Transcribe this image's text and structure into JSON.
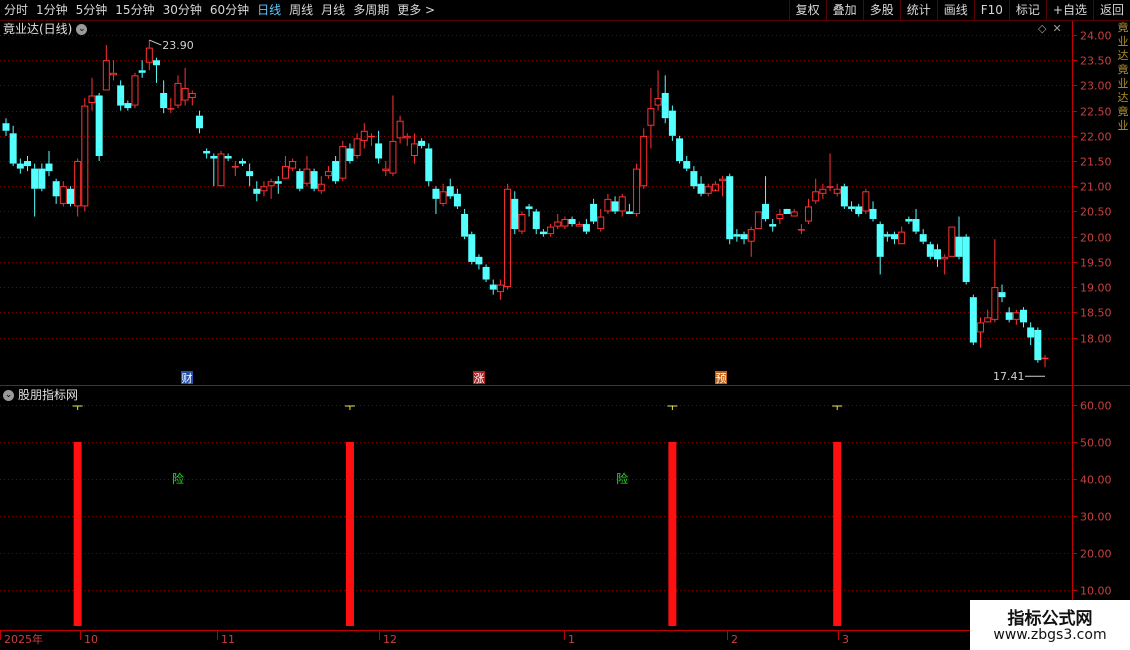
{
  "toolbar": {
    "periods": [
      "分时",
      "1分钟",
      "5分钟",
      "15分钟",
      "30分钟",
      "60分钟",
      "日线",
      "周线",
      "月线",
      "多周期",
      "更多 >"
    ],
    "active_period": "日线",
    "right_buttons": [
      "复权",
      "叠加",
      "多股",
      "统计",
      "画线",
      "F10",
      "标记",
      "+自选",
      "返回"
    ]
  },
  "main_title": "竟业达(日线)",
  "sub_title": "股朋指标网",
  "side_strip": "竟业达竟业达竟业",
  "colors": {
    "up": "#ff3232",
    "down": "#54ffff",
    "signal": "#ff1010",
    "grid": "#7a0000",
    "axis": "#c00000",
    "label_green": "#2ee02e",
    "marker_yellow": "#e8e840"
  },
  "chart_data": [
    {
      "type": "candlestick",
      "title": "竟业达(日线)",
      "ylim": [
        17.0,
        24.4
      ],
      "yticks": [
        "24.00",
        "23.50",
        "23.00",
        "22.50",
        "22.00",
        "21.50",
        "21.00",
        "20.50",
        "20.00",
        "19.50",
        "19.00",
        "18.50",
        "18.00"
      ],
      "max_label": "23.90",
      "min_label": "17.41",
      "event_markers": [
        "财",
        "涨",
        "预"
      ],
      "x_ticks": [
        "2025年",
        "10",
        "11",
        "12",
        "1",
        "2",
        "3"
      ],
      "candles": [
        [
          22.25,
          22.1,
          22.35,
          22.0
        ],
        [
          22.05,
          21.45,
          22.2,
          21.4
        ],
        [
          21.45,
          21.35,
          21.55,
          21.25
        ],
        [
          21.5,
          21.4,
          21.6,
          21.3
        ],
        [
          21.35,
          20.95,
          21.45,
          20.4
        ],
        [
          21.35,
          20.95,
          21.45,
          20.9
        ],
        [
          21.45,
          21.3,
          21.7,
          21.2
        ],
        [
          21.1,
          20.8,
          21.15,
          20.65
        ],
        [
          20.65,
          21.0,
          21.1,
          20.6
        ],
        [
          20.95,
          20.65,
          21.0,
          20.6
        ],
        [
          20.6,
          21.5,
          21.55,
          20.4
        ],
        [
          20.6,
          22.6,
          22.75,
          20.5
        ],
        [
          22.65,
          22.8,
          23.15,
          22.5
        ],
        [
          22.8,
          21.6,
          22.85,
          21.5
        ],
        [
          22.9,
          23.5,
          23.8,
          22.9
        ],
        [
          23.2,
          23.25,
          23.5,
          23.1
        ],
        [
          23.0,
          22.6,
          23.1,
          22.5
        ],
        [
          22.65,
          22.55,
          22.7,
          22.5
        ],
        [
          22.6,
          23.2,
          23.25,
          22.55
        ],
        [
          23.3,
          23.25,
          23.5,
          23.15
        ],
        [
          23.45,
          23.75,
          23.9,
          23.3
        ],
        [
          23.5,
          23.4,
          23.55,
          23.05
        ],
        [
          22.85,
          22.55,
          23.1,
          22.45
        ],
        [
          22.55,
          22.55,
          22.75,
          22.45
        ],
        [
          22.6,
          23.05,
          23.2,
          22.55
        ],
        [
          22.7,
          22.95,
          23.35,
          22.6
        ],
        [
          22.75,
          22.85,
          22.9,
          22.6
        ],
        [
          22.4,
          22.15,
          22.5,
          22.05
        ],
        [
          21.7,
          21.65,
          21.75,
          21.55
        ],
        [
          21.6,
          21.55,
          21.65,
          21.0
        ],
        [
          21.0,
          21.65,
          21.7,
          21.0
        ],
        [
          21.6,
          21.55,
          21.65,
          21.5
        ],
        [
          21.4,
          21.4,
          21.5,
          21.2
        ],
        [
          21.5,
          21.45,
          21.55,
          21.4
        ],
        [
          21.3,
          21.2,
          21.45,
          21.0
        ],
        [
          20.95,
          20.85,
          21.1,
          20.7
        ],
        [
          20.9,
          21.0,
          21.1,
          20.8
        ],
        [
          21.0,
          21.1,
          21.15,
          20.75
        ],
        [
          21.1,
          21.05,
          21.2,
          20.85
        ],
        [
          21.15,
          21.4,
          21.6,
          21.15
        ],
        [
          21.35,
          21.5,
          21.55,
          21.3
        ],
        [
          21.3,
          20.95,
          21.35,
          20.9
        ],
        [
          21.05,
          21.35,
          21.6,
          21.0
        ],
        [
          21.3,
          20.95,
          21.35,
          20.9
        ],
        [
          20.9,
          21.05,
          21.2,
          20.85
        ],
        [
          21.2,
          21.3,
          21.4,
          21.15
        ],
        [
          21.5,
          21.1,
          21.6,
          21.05
        ],
        [
          21.15,
          21.8,
          21.9,
          21.1
        ],
        [
          21.75,
          21.5,
          21.85,
          21.45
        ],
        [
          21.6,
          21.95,
          22.05,
          21.55
        ],
        [
          21.9,
          22.1,
          22.25,
          21.75
        ],
        [
          22.0,
          22.0,
          22.05,
          21.8
        ],
        [
          21.85,
          21.55,
          22.1,
          21.45
        ],
        [
          21.3,
          21.35,
          21.5,
          21.2
        ],
        [
          21.25,
          21.9,
          22.8,
          21.2
        ],
        [
          21.95,
          22.3,
          22.4,
          21.85
        ],
        [
          21.95,
          22.0,
          22.05,
          21.8
        ],
        [
          21.6,
          21.85,
          22.05,
          21.45
        ],
        [
          21.9,
          21.8,
          21.95,
          21.75
        ],
        [
          21.75,
          21.1,
          21.85,
          21.0
        ],
        [
          20.95,
          20.75,
          21.0,
          20.45
        ],
        [
          20.65,
          20.9,
          21.05,
          20.6
        ],
        [
          21.0,
          20.8,
          21.15,
          20.75
        ],
        [
          20.85,
          20.6,
          20.95,
          20.55
        ],
        [
          20.45,
          20.0,
          20.55,
          19.95
        ],
        [
          20.05,
          19.5,
          20.1,
          19.45
        ],
        [
          19.6,
          19.45,
          19.65,
          19.35
        ],
        [
          19.4,
          19.15,
          19.45,
          19.1
        ],
        [
          19.05,
          18.95,
          19.15,
          18.85
        ],
        [
          18.9,
          19.05,
          19.15,
          18.75
        ],
        [
          19.0,
          20.95,
          21.05,
          18.95
        ],
        [
          20.75,
          20.15,
          20.9,
          20.05
        ],
        [
          20.1,
          20.45,
          20.5,
          20.05
        ],
        [
          20.6,
          20.55,
          20.65,
          20.4
        ],
        [
          20.5,
          20.15,
          20.55,
          20.05
        ],
        [
          20.1,
          20.05,
          20.15,
          20.0
        ],
        [
          20.05,
          20.2,
          20.25,
          20.0
        ],
        [
          20.2,
          20.3,
          20.45,
          20.15
        ],
        [
          20.2,
          20.35,
          20.4,
          20.15
        ],
        [
          20.35,
          20.25,
          20.4,
          20.2
        ],
        [
          20.2,
          20.25,
          20.3,
          20.2
        ],
        [
          20.25,
          20.1,
          20.35,
          20.05
        ],
        [
          20.65,
          20.3,
          20.75,
          20.25
        ],
        [
          20.15,
          20.4,
          20.55,
          20.1
        ],
        [
          20.5,
          20.75,
          20.85,
          20.45
        ],
        [
          20.7,
          20.5,
          20.8,
          20.45
        ],
        [
          20.5,
          20.8,
          20.85,
          20.4
        ],
        [
          20.5,
          20.45,
          20.65,
          20.45
        ],
        [
          20.45,
          21.35,
          21.45,
          20.4
        ],
        [
          21.0,
          22.0,
          22.15,
          20.95
        ],
        [
          22.2,
          22.55,
          22.95,
          21.75
        ],
        [
          22.6,
          22.75,
          23.3,
          22.5
        ],
        [
          22.85,
          22.35,
          23.2,
          22.25
        ],
        [
          22.5,
          22.0,
          22.6,
          21.9
        ],
        [
          21.95,
          21.5,
          22.0,
          21.45
        ],
        [
          21.5,
          21.35,
          21.6,
          21.3
        ],
        [
          21.3,
          21.0,
          21.4,
          20.95
        ],
        [
          21.05,
          20.85,
          21.2,
          20.8
        ],
        [
          20.85,
          21.0,
          21.05,
          20.8
        ],
        [
          20.9,
          21.05,
          21.1,
          20.95
        ],
        [
          21.1,
          21.15,
          21.2,
          20.8
        ],
        [
          21.2,
          19.95,
          21.25,
          19.85
        ],
        [
          20.05,
          20.0,
          20.15,
          19.9
        ],
        [
          20.05,
          19.95,
          20.1,
          19.85
        ],
        [
          19.9,
          20.15,
          20.2,
          19.6
        ],
        [
          20.15,
          20.5,
          20.5,
          20.15
        ],
        [
          20.65,
          20.35,
          21.2,
          20.3
        ],
        [
          20.25,
          20.2,
          20.35,
          20.1
        ],
        [
          20.35,
          20.45,
          20.55,
          20.25
        ],
        [
          20.55,
          20.45,
          20.55,
          20.45
        ],
        [
          20.4,
          20.5,
          20.55,
          20.4
        ],
        [
          20.15,
          20.15,
          20.25,
          20.05
        ],
        [
          20.3,
          20.6,
          20.75,
          20.25
        ],
        [
          20.7,
          20.9,
          21.15,
          20.65
        ],
        [
          20.85,
          20.95,
          21.05,
          20.75
        ],
        [
          21.0,
          21.0,
          21.65,
          20.9
        ],
        [
          20.85,
          20.95,
          21.05,
          20.8
        ],
        [
          21.0,
          20.6,
          21.05,
          20.55
        ],
        [
          20.6,
          20.55,
          20.7,
          20.5
        ],
        [
          20.6,
          20.45,
          20.65,
          20.4
        ],
        [
          20.5,
          20.9,
          20.95,
          20.45
        ],
        [
          20.55,
          20.35,
          20.7,
          20.3
        ],
        [
          20.25,
          19.6,
          20.3,
          19.25
        ],
        [
          20.05,
          20.0,
          20.1,
          19.9
        ],
        [
          20.05,
          19.95,
          20.1,
          19.85
        ],
        [
          19.85,
          20.1,
          20.2,
          19.85
        ],
        [
          20.35,
          20.3,
          20.4,
          20.25
        ],
        [
          20.35,
          20.1,
          20.55,
          20.05
        ],
        [
          20.05,
          19.9,
          20.15,
          19.85
        ],
        [
          19.85,
          19.6,
          19.9,
          19.55
        ],
        [
          19.75,
          19.55,
          19.85,
          19.4
        ],
        [
          19.55,
          19.6,
          19.65,
          19.25
        ],
        [
          19.6,
          20.2,
          20.2,
          19.6
        ],
        [
          20.0,
          19.6,
          20.4,
          19.55
        ],
        [
          20.0,
          19.1,
          20.05,
          19.05
        ],
        [
          18.8,
          17.9,
          18.85,
          17.85
        ],
        [
          18.1,
          18.3,
          18.4,
          17.8
        ],
        [
          18.3,
          18.4,
          18.55,
          18.3
        ],
        [
          18.35,
          19.0,
          19.95,
          18.3
        ],
        [
          18.9,
          18.8,
          19.05,
          18.7
        ],
        [
          18.5,
          18.35,
          18.6,
          18.3
        ],
        [
          18.35,
          18.5,
          18.55,
          18.25
        ],
        [
          18.55,
          18.3,
          18.6,
          18.2
        ],
        [
          18.2,
          18.0,
          18.3,
          17.85
        ],
        [
          18.15,
          17.55,
          18.2,
          17.5
        ],
        [
          17.6,
          17.6,
          17.65,
          17.41
        ]
      ]
    },
    {
      "type": "bar",
      "title": "股朋指标网",
      "ylim": [
        0,
        65
      ],
      "yticks": [
        "60.00",
        "50.00",
        "40.00",
        "30.00",
        "20.00",
        "10.00"
      ],
      "signal_value": 50,
      "marker_value": 60,
      "signal_indices": [
        10,
        48,
        93,
        116
      ],
      "label_text": "险",
      "label_value": 40,
      "label_indices": [
        24,
        86
      ]
    }
  ],
  "watermark": {
    "line1": "指标公式网",
    "line2": "www.zbgs3.com"
  }
}
